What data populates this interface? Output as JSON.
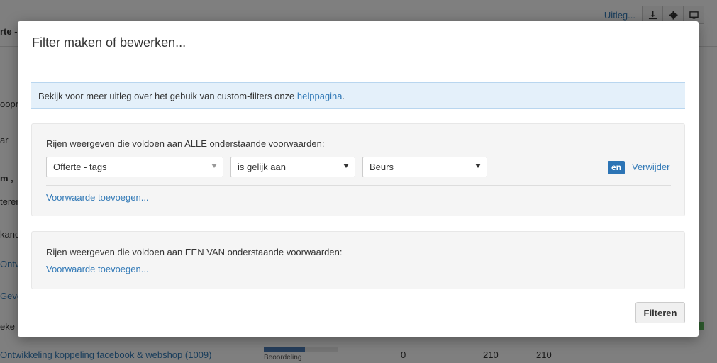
{
  "background": {
    "breadcrumb": "rte - ",
    "header_link": "Uitleg...",
    "side_texts": [
      "oopr",
      "ar",
      "m ,",
      "teren",
      "kand",
      "Ontv",
      "Geve",
      "eke"
    ],
    "table_row": {
      "title": "Ontwikkeling koppeling facebook & webshop (1009)",
      "progress_label": "Beoordeling",
      "progress_fraction": 0.56,
      "col1": "0",
      "col2": "210",
      "col3": "210"
    }
  },
  "modal": {
    "title": "Filter maken of bewerken...",
    "info": {
      "text": "Bekijk voor meer uitleg over het gebuik van custom-filters onze ",
      "link": "helppagina",
      "suffix": "."
    },
    "all_section": {
      "label": "Rijen weergeven die voldoen aan ALLE onderstaande voorwaarden:",
      "condition": {
        "field": "Offerte - tags",
        "operator": "is gelijk aan",
        "value": "Beurs",
        "connector": "en",
        "remove_label": "Verwijder"
      },
      "add_label": "Voorwaarde toevoegen..."
    },
    "any_section": {
      "label": "Rijen weergeven die voldoen aan EEN VAN onderstaande voorwaarden:",
      "add_label": "Voorwaarde toevoegen..."
    },
    "submit_label": "Filteren"
  },
  "colors": {
    "accent": "#337ab7",
    "info_bg": "#e4f0fa",
    "badge": "#2c74b5"
  }
}
